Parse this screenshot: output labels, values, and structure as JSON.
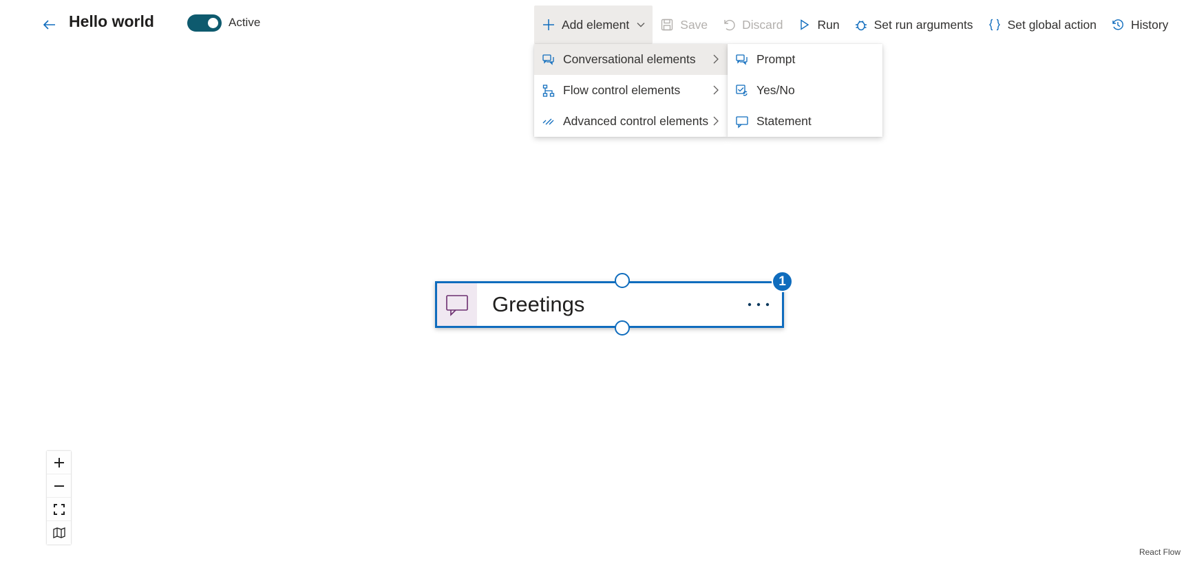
{
  "header": {
    "back_label": "Back",
    "title": "Hello world",
    "toggle_label": "Active",
    "toggle_on": true
  },
  "toolbar": {
    "add_element": "Add element",
    "save": "Save",
    "discard": "Discard",
    "run": "Run",
    "set_run_arguments": "Set run arguments",
    "set_global_action": "Set global action",
    "history": "History"
  },
  "menu": {
    "items": [
      {
        "label": "Conversational elements",
        "icon": "conversation-icon"
      },
      {
        "label": "Flow control elements",
        "icon": "flow-control-icon"
      },
      {
        "label": "Advanced control elements",
        "icon": "advanced-control-icon"
      }
    ],
    "submenu": [
      {
        "label": "Prompt",
        "icon": "prompt-icon"
      },
      {
        "label": "Yes/No",
        "icon": "yes-no-icon"
      },
      {
        "label": "Statement",
        "icon": "statement-icon"
      }
    ]
  },
  "node": {
    "title": "Greetings",
    "badge": "1"
  },
  "controls": {
    "zoom_in": "zoom-in",
    "zoom_out": "zoom-out",
    "fit_view": "fit-view",
    "minimap": "minimap"
  },
  "attribution": "React Flow",
  "colors": {
    "accent": "#0f6cbd",
    "toggle": "#0e5a6e",
    "node_icon_bg": "#f0e8f1",
    "node_icon": "#6b2d6f"
  }
}
